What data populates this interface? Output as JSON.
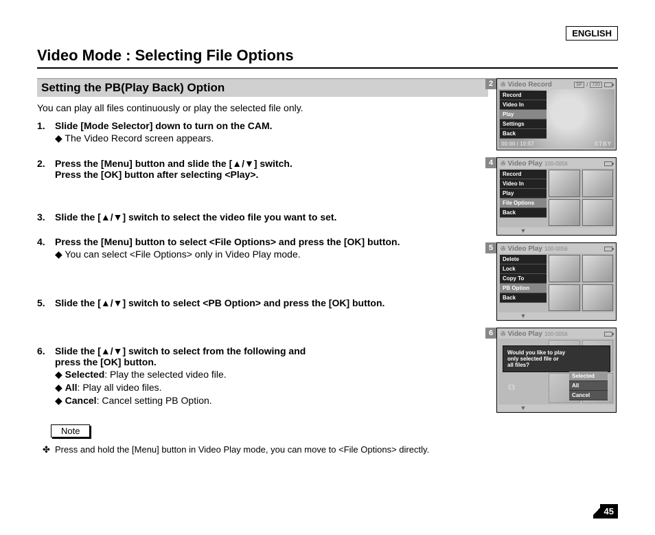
{
  "language_label": "ENGLISH",
  "page_title": "Video Mode : Selecting File Options",
  "section_title": "Setting the PB(Play Back) Option",
  "intro": "You can play all files continuously or play the selected file only.",
  "steps": [
    {
      "main": "Slide [Mode Selector] down to turn on the CAM.",
      "subs": [
        "The Video Record screen appears."
      ]
    },
    {
      "main_lines": [
        "Press the [Menu] button and slide the [▲/▼] switch.",
        "Press the [OK] button after selecting <Play>."
      ]
    },
    {
      "main": "Slide the [▲/▼] switch to select the video file you want to set."
    },
    {
      "main": "Press the [Menu] button to select <File Options> and press the [OK] button.",
      "subs": [
        "You can select <File Options> only in Video Play mode."
      ]
    },
    {
      "main": "Slide the [▲/▼] switch to select <PB Option> and press the [OK] button."
    },
    {
      "main_lines": [
        "Slide the [▲/▼] switch to select from the following and",
        "press the [OK] button."
      ],
      "bullets": [
        {
          "bold": "Selected",
          "rest": ": Play the selected video file."
        },
        {
          "bold": "All",
          "rest": ": Play all video files."
        },
        {
          "bold": "Cancel",
          "rest": ": Cancel setting PB Option."
        }
      ]
    }
  ],
  "note_label": "Note",
  "note_text": "Press and hold the [Menu] button in Video Play mode, you can move to <File Options> directly.",
  "page_number": "45",
  "screens": {
    "s2": {
      "num": "2",
      "title": "Video Record",
      "badges": [
        "SF",
        "/",
        "720"
      ],
      "menu": [
        "Record",
        "Video In",
        "Play",
        "Settings",
        "Back"
      ],
      "highlight_idx": 2,
      "time": "00:00 / 10:57",
      "status": "STBY"
    },
    "s4": {
      "num": "4",
      "title": "Video Play",
      "file": "100-0056",
      "menu": [
        "Record",
        "Video In",
        "Play",
        "File Options",
        "Back"
      ],
      "highlight_idx": 3
    },
    "s5": {
      "num": "5",
      "title": "Video Play",
      "file": "100-0056",
      "menu": [
        "Delete",
        "Lock",
        "Copy To",
        "PB Option",
        "Back"
      ],
      "highlight_idx": 3
    },
    "s6": {
      "num": "6",
      "title": "Video Play",
      "file": "100-0056",
      "dialog_lines": [
        "Would you like to play",
        "only selected file or",
        "all files?"
      ],
      "options": [
        "Selected",
        "All",
        "Cancel"
      ],
      "highlight_idx": 0
    }
  }
}
